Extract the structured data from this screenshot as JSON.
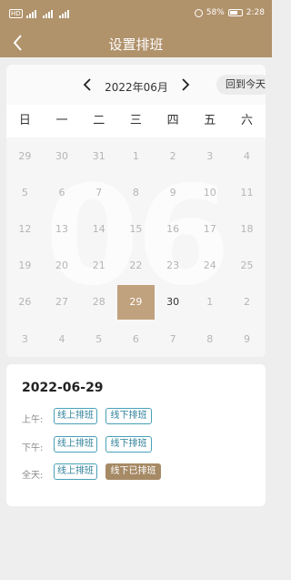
{
  "status_bar": {
    "left_indicators": "HD",
    "battery": "58%",
    "time": "2:28"
  },
  "nav": {
    "title": "设置排班",
    "back_icon": "chevron-left-icon"
  },
  "calendar": {
    "month_label": "2022年06月",
    "watermark": "06",
    "today_button": "回到今天",
    "weekdays": [
      "日",
      "一",
      "二",
      "三",
      "四",
      "五",
      "六"
    ],
    "days": [
      {
        "d": "29",
        "state": "other"
      },
      {
        "d": "30",
        "state": "other"
      },
      {
        "d": "31",
        "state": "other"
      },
      {
        "d": "1",
        "state": "other"
      },
      {
        "d": "2",
        "state": "other"
      },
      {
        "d": "3",
        "state": "other"
      },
      {
        "d": "4",
        "state": "other"
      },
      {
        "d": "5",
        "state": "other"
      },
      {
        "d": "6",
        "state": "other"
      },
      {
        "d": "7",
        "state": "other"
      },
      {
        "d": "8",
        "state": "other"
      },
      {
        "d": "9",
        "state": "other"
      },
      {
        "d": "10",
        "state": "other"
      },
      {
        "d": "11",
        "state": "other"
      },
      {
        "d": "12",
        "state": "other"
      },
      {
        "d": "13",
        "state": "other"
      },
      {
        "d": "14",
        "state": "other"
      },
      {
        "d": "15",
        "state": "other"
      },
      {
        "d": "16",
        "state": "other"
      },
      {
        "d": "17",
        "state": "other"
      },
      {
        "d": "18",
        "state": "other"
      },
      {
        "d": "19",
        "state": "other"
      },
      {
        "d": "20",
        "state": "other"
      },
      {
        "d": "21",
        "state": "other"
      },
      {
        "d": "22",
        "state": "other"
      },
      {
        "d": "23",
        "state": "other"
      },
      {
        "d": "24",
        "state": "other"
      },
      {
        "d": "25",
        "state": "other"
      },
      {
        "d": "26",
        "state": "other"
      },
      {
        "d": "27",
        "state": "other"
      },
      {
        "d": "28",
        "state": "other"
      },
      {
        "d": "29",
        "state": "selected"
      },
      {
        "d": "30",
        "state": "current"
      },
      {
        "d": "1",
        "state": "other"
      },
      {
        "d": "2",
        "state": "other"
      },
      {
        "d": "3",
        "state": "other"
      },
      {
        "d": "4",
        "state": "other"
      },
      {
        "d": "5",
        "state": "other"
      },
      {
        "d": "6",
        "state": "other"
      },
      {
        "d": "7",
        "state": "other"
      },
      {
        "d": "8",
        "state": "other"
      },
      {
        "d": "9",
        "state": "other"
      }
    ]
  },
  "detail": {
    "date": "2022-06-29",
    "rows": [
      {
        "label": "上午:",
        "online": "线上排班",
        "offline": "线下排班",
        "offline_filled": false
      },
      {
        "label": "下午:",
        "online": "线上排班",
        "offline": "线下排班",
        "offline_filled": false
      },
      {
        "label": "全天:",
        "online": "线上排班",
        "offline": "线下已排班",
        "offline_filled": true
      }
    ]
  },
  "colors": {
    "brand": "#b0926b",
    "selected_day": "#c0a27e",
    "tag_border": "#4aa0b8",
    "tag_filled": "#a68a66"
  }
}
